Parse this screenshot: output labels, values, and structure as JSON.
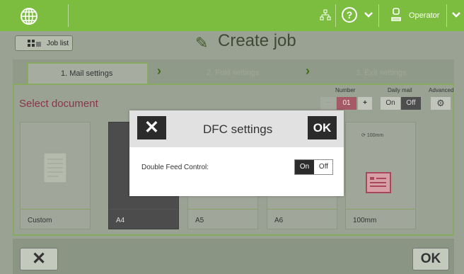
{
  "header": {
    "user": "Operator"
  },
  "nav": {
    "back": "Job list",
    "title": "Create job"
  },
  "tabs": [
    "1. Mail settings",
    "2. Fold settings",
    "3. Exit settings"
  ],
  "main": {
    "section_title": "Select document",
    "number_label": "Number",
    "number_value": "01",
    "daily_mail_label": "Daily mail",
    "daily_on": "On",
    "daily_off": "Off",
    "advanced_label": "Advanced",
    "cards": [
      "Custom",
      "A4",
      "A5",
      "A6",
      "100mm"
    ],
    "card_sub": "100mm"
  },
  "dialog": {
    "title": "DFC settings",
    "ok": "OK",
    "label": "Double Feed Control:",
    "on": "On",
    "off": "Off"
  },
  "footer": {
    "ok": "OK"
  },
  "colors": {
    "accent": "#7cbd3f",
    "section": "#8b3448",
    "toggle_on": "#2b2b2b"
  }
}
